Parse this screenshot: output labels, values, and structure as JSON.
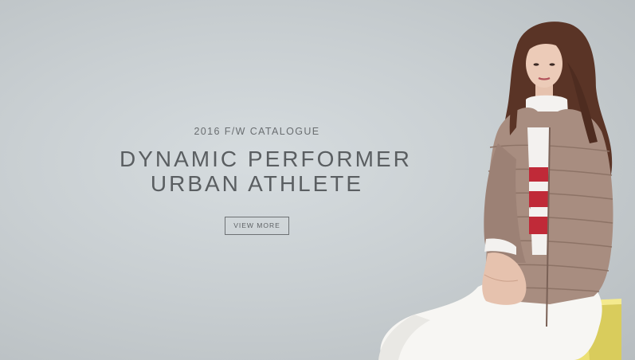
{
  "hero": {
    "eyebrow": "2016 F/W CATALOGUE",
    "headline_line1": "DYNAMIC PERFORMER",
    "headline_line2": "URBAN ATHLETE",
    "cta_label": "VIEW MORE"
  },
  "colors": {
    "background": "#c9cfd2",
    "text": "#5a5e61",
    "jacket": "#a88d80",
    "stool": "#ecdf73"
  }
}
